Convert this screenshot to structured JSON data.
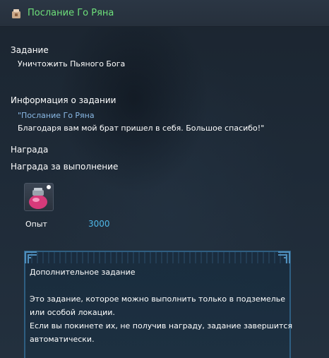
{
  "window": {
    "title": "Послание Го Ряна",
    "icon": "scroll-bag-icon",
    "title_color": "#6ee07a"
  },
  "task": {
    "heading": "Задание",
    "objective": "Уничтожить Пьяного Бога"
  },
  "info": {
    "heading": "Информация о задании",
    "quote_title": "\"Послание Го Ряна",
    "quote_text": "Благодаря вам мой брат пришел в себя. Большое спасибо!\""
  },
  "reward": {
    "heading": "Награда",
    "subheading": "Награда за выполнение",
    "item_icon": "potion-jar-icon",
    "exp_label": "Опыт",
    "exp_value": "3000",
    "exp_color": "#4fb8e8"
  },
  "extra": {
    "title": "Дополнительное задание",
    "lines": [
      "Это задание, которое можно выполнить только в подземелье",
      "или особой локации.",
      "Если вы покинете их, не получив награду, задание завершится",
      "автоматически."
    ]
  }
}
